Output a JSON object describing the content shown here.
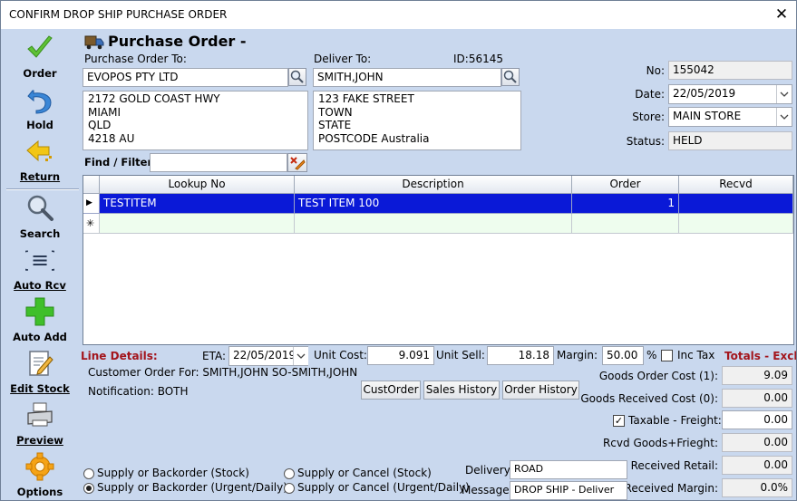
{
  "window": {
    "title": "CONFIRM DROP SHIP PURCHASE ORDER",
    "close": "✕"
  },
  "sidebar": {
    "order": "Order",
    "hold": "Hold",
    "return": "Return",
    "search": "Search",
    "auto_rcv": "Auto Rcv",
    "auto_add": "Auto Add",
    "edit_stock": "Edit Stock",
    "preview": "Preview",
    "options": "Options"
  },
  "header": {
    "title": "Purchase Order -",
    "po_to_label": "Purchase Order To:",
    "deliver_to_label": "Deliver To:",
    "id_label": "ID:56145",
    "supplier": "EVOPOS PTY LTD",
    "supplier_address": [
      "2172 GOLD COAST HWY",
      "MIAMI",
      "QLD",
      "4218 AU"
    ],
    "deliver_name": "SMITH,JOHN",
    "deliver_address": [
      "123 FAKE STREET",
      "TOWN",
      "STATE",
      "POSTCODE Australia"
    ],
    "find_filter_label": "Find / Filter:",
    "find_filter_value": ""
  },
  "info": {
    "no_label": "No:",
    "no_value": "155042",
    "date_label": "Date:",
    "date_value": "22/05/2019",
    "store_label": "Store:",
    "store_value": "MAIN STORE",
    "status_label": "Status:",
    "status_value": "HELD"
  },
  "grid": {
    "columns": [
      "Lookup No",
      "Description",
      "Order",
      "Recvd"
    ],
    "rows": [
      {
        "lookup": "TESTITEM",
        "description": "TEST ITEM 100",
        "order": "1",
        "recvd": ""
      }
    ],
    "new_row_marker": "✳",
    "current_row_marker": "▶"
  },
  "line_details": {
    "label": "Line Details:",
    "eta_label": "ETA:",
    "eta_value": "22/05/2019",
    "unit_cost_label": "Unit Cost:",
    "unit_cost_value": "9.091",
    "unit_sell_label": "Unit Sell:",
    "unit_sell_value": "18.18",
    "margin_label": "Margin:",
    "margin_value": "50.00",
    "percent": "%",
    "inc_tax_label": "Inc Tax",
    "customer_order": "Customer Order For: SMITH,JOHN SO-SMITH,JOHN",
    "notification": "Notification: BOTH",
    "cust_order_btn": "CustOrder",
    "sales_history_btn": "Sales History",
    "order_history_btn": "Order History"
  },
  "options": {
    "supply_backorder_stock": "Supply or Backorder (Stock)",
    "supply_backorder_urgent": "Supply or Backorder (Urgent/Daily)",
    "supply_cancel_stock": "Supply or Cancel (Stock)",
    "supply_cancel_urgent": "Supply or Cancel (Urgent/Daily)",
    "delivery_label": "Delivery:",
    "delivery_value": "ROAD",
    "message_label": "Message:",
    "message_value": "DROP SHIP - Deliver"
  },
  "totals": {
    "title": "Totals - Excl",
    "goods_order_cost_label": "Goods Order Cost (1):",
    "goods_order_cost": "9.09",
    "goods_received_cost_label": "Goods Received Cost (0):",
    "goods_received_cost": "0.00",
    "taxable_freight_label": "Taxable - Freight:",
    "taxable_freight": "0.00",
    "rcvd_goods_freight_label": "Rcvd Goods+Frieght:",
    "rcvd_goods_freight": "0.00",
    "received_retail_label": "Received Retail:",
    "received_retail": "0.00",
    "received_margin_label": "Received Margin:",
    "received_margin": "0.0%"
  },
  "colors": {
    "background": "#c9d8ee",
    "selection": "#0a19d7",
    "new_row": "#eefdee",
    "accent_red": "#a3151c"
  }
}
